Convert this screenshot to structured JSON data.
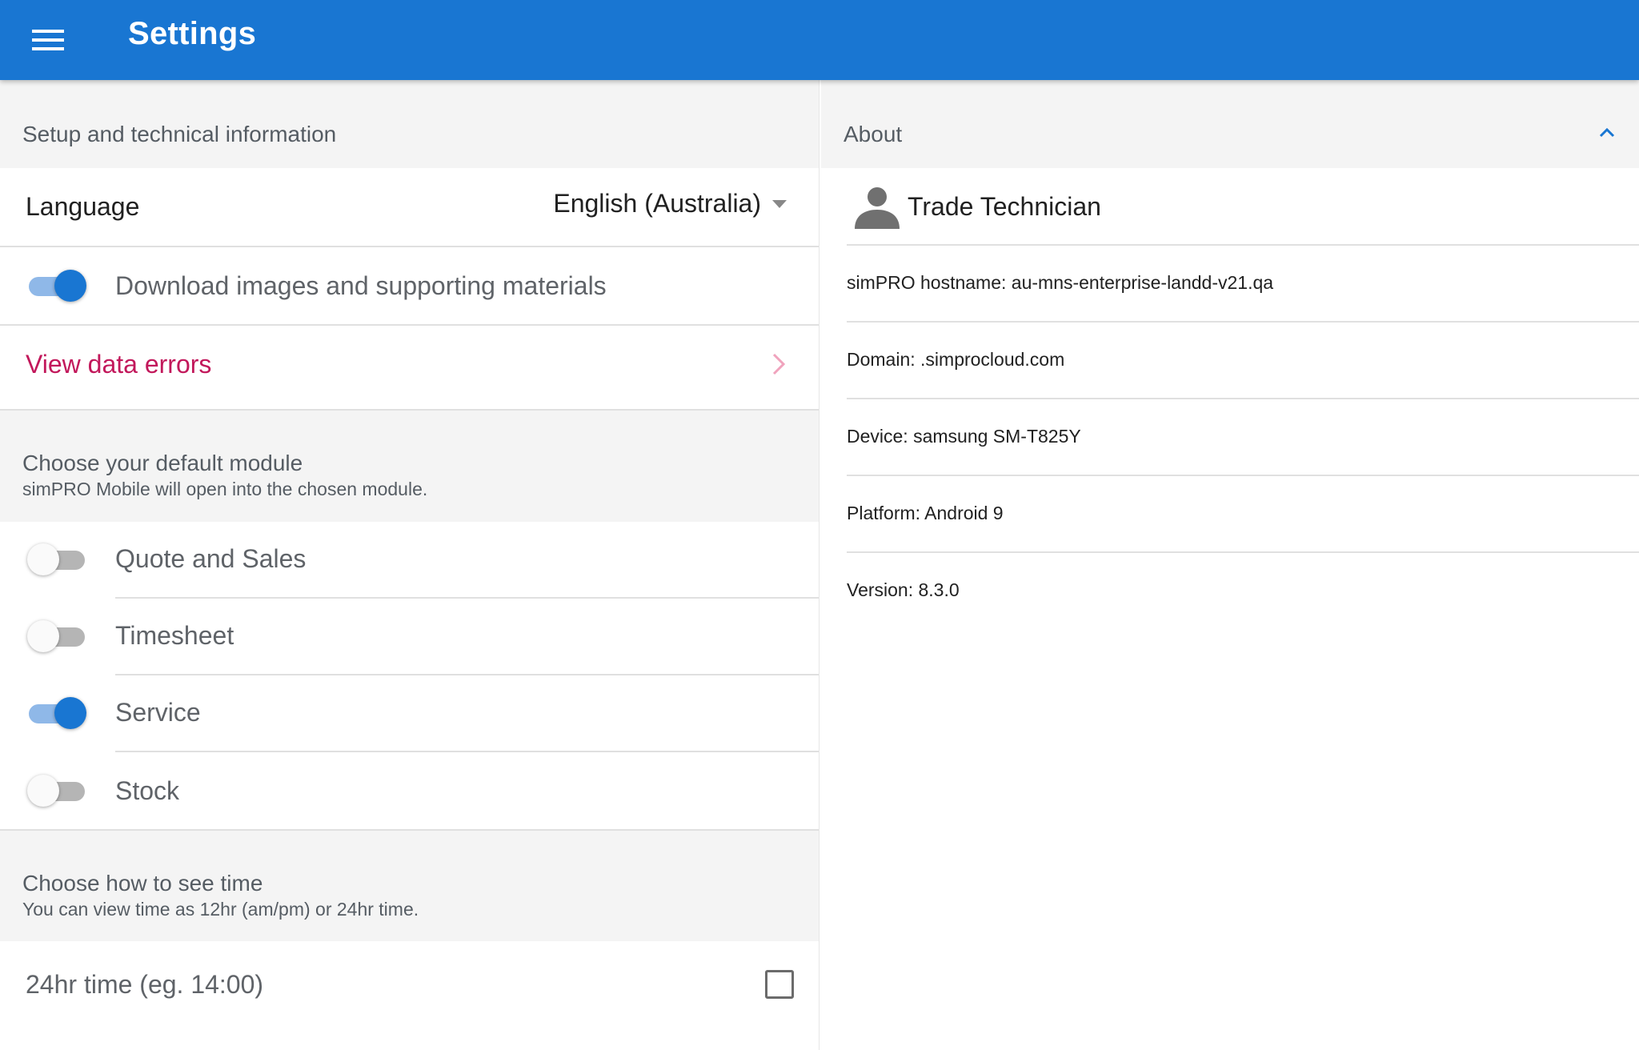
{
  "appbar": {
    "title": "Settings",
    "menu_icon": "hamburger-menu-icon",
    "color": "#1976d2"
  },
  "left": {
    "setup_header": "Setup and technical information",
    "language": {
      "label": "Language",
      "value": "English (Australia)"
    },
    "download_images": {
      "label": "Download images and supporting materials",
      "enabled": true
    },
    "view_data_errors": {
      "label": "View data errors",
      "color": "#c2185b"
    },
    "default_module": {
      "title": "Choose your default module",
      "subtitle": "simPRO Mobile will open into the chosen module.",
      "options": [
        {
          "label": "Quote and Sales",
          "enabled": false
        },
        {
          "label": "Timesheet",
          "enabled": false
        },
        {
          "label": "Service",
          "enabled": true
        },
        {
          "label": "Stock",
          "enabled": false
        }
      ]
    },
    "time_format": {
      "title": "Choose how to see time",
      "subtitle": "You can view time as 12hr (am/pm) or 24hr time.",
      "option_label": "24hr time (eg. 14:00)",
      "checked": false
    }
  },
  "right": {
    "about_header": "About",
    "user_role": "Trade Technician",
    "hostname": "simPRO hostname: au-mns-enterprise-landd-v21.qa",
    "domain": "Domain: .simprocloud.com",
    "device": "Device: samsung SM-T825Y",
    "platform": "Platform: Android 9",
    "version": "Version: 8.3.0"
  }
}
